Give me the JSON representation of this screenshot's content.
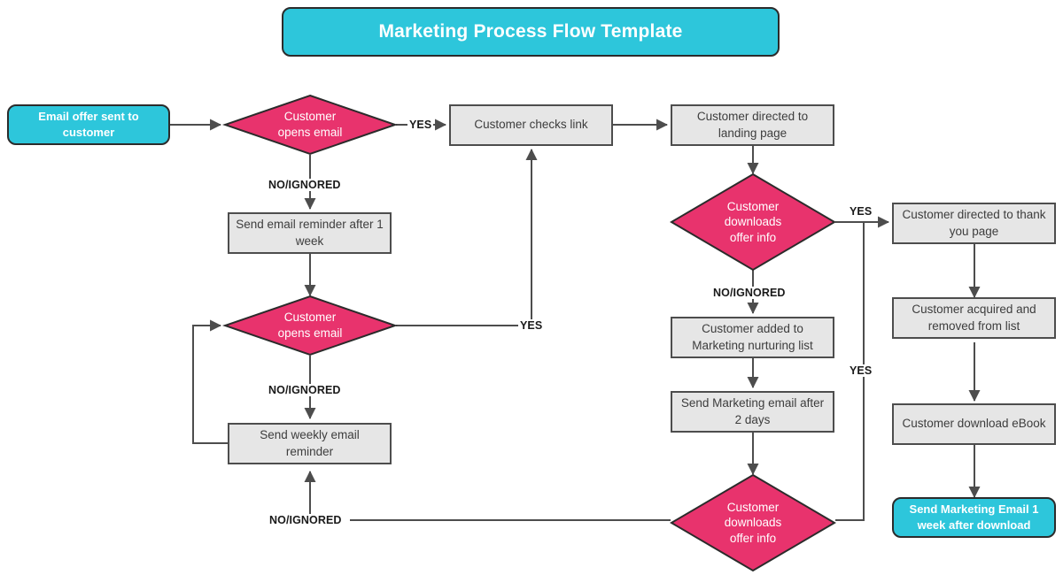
{
  "title": {
    "text": "Marketing Process Flow Template"
  },
  "colors": {
    "accent_cyan": "#2DC6DB",
    "decision_pink": "#E8336D",
    "process_gray": "#E6E6E6",
    "border_dark": "#4D4D4D",
    "edge_stroke": "#4D4D4D",
    "title_text": "#FFFFFF"
  },
  "nodes": {
    "start": {
      "label": "Email offer sent to customer",
      "type": "terminator"
    },
    "decision_opens_email_1": {
      "label_line1": "Customer",
      "label_line2": "opens email",
      "type": "decision"
    },
    "checks_link": {
      "label": "Customer checks link",
      "type": "process"
    },
    "landing_page": {
      "label": "Customer directed to landing page",
      "type": "process"
    },
    "reminder_1week": {
      "label": "Send email reminder after 1 week",
      "type": "process"
    },
    "decision_opens_email_2": {
      "label_line1": "Customer",
      "label_line2": "opens email",
      "type": "decision"
    },
    "weekly_reminder": {
      "label": "Send weekly email reminder",
      "type": "process"
    },
    "decision_downloads_1": {
      "label_line1": "Customer",
      "label_line2": "downloads",
      "label_line3": "offer info",
      "type": "decision"
    },
    "nurturing_list": {
      "label": "Customer added to Marketing nurturing list",
      "type": "process"
    },
    "marketing_email_2days": {
      "label": "Send Marketing email after 2 days",
      "type": "process"
    },
    "decision_downloads_2": {
      "label_line1": "Customer",
      "label_line2": "downloads",
      "label_line3": "offer info",
      "type": "decision"
    },
    "thank_you_page": {
      "label": "Customer directed to thank you page",
      "type": "process"
    },
    "acquired_removed": {
      "label": "Customer acquired and removed from list",
      "type": "process"
    },
    "download_ebook": {
      "label": "Customer download eBook",
      "type": "process"
    },
    "end": {
      "label": "Send Marketing Email 1 week after download",
      "type": "terminator"
    }
  },
  "edge_labels": {
    "yes_1": "YES",
    "no_1": "NO/IGNORED",
    "yes_2": "YES",
    "no_2": "NO/IGNORED",
    "yes_3": "YES",
    "no_3": "NO/IGNORED",
    "yes_4": "YES",
    "no_4": "NO/IGNORED"
  }
}
